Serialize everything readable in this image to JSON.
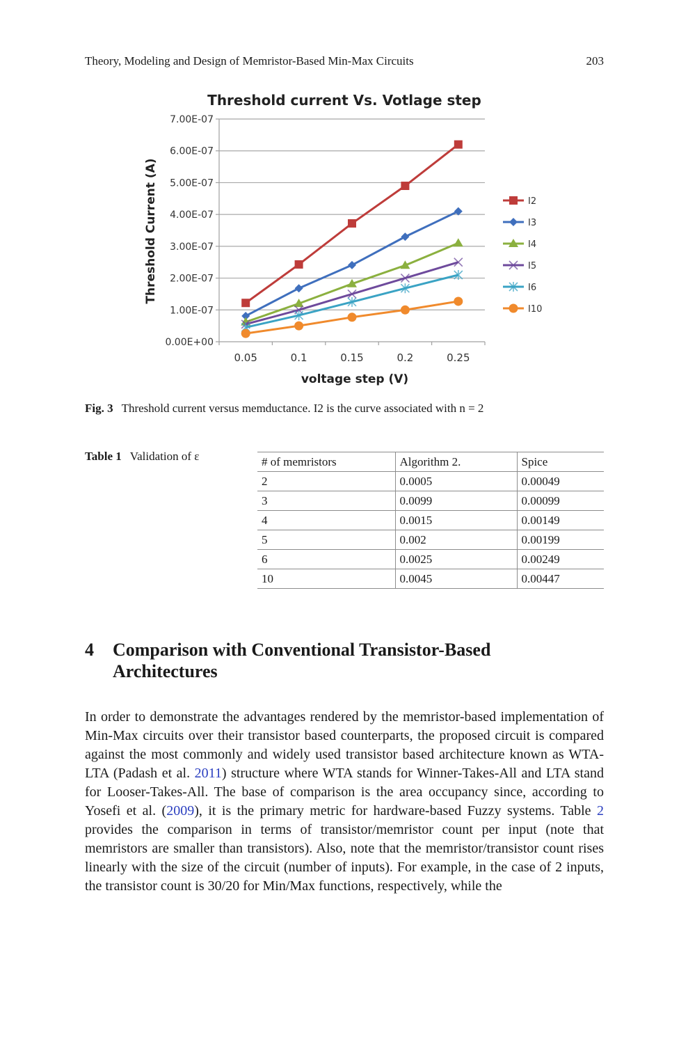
{
  "header": {
    "running_title": "Theory, Modeling and Design of Memristor-Based Min-Max Circuits",
    "page_number": "203"
  },
  "chart_data": {
    "type": "line",
    "title": "Threshold current Vs. Votlage step",
    "xlabel": "voltage step (V)",
    "ylabel": "Threshold Current (A)",
    "categories": [
      "0.05",
      "0.1",
      "0.15",
      "0.2",
      "0.25"
    ],
    "x": [
      0.05,
      0.1,
      0.15,
      0.2,
      0.25
    ],
    "ylim": [
      0,
      7e-07
    ],
    "yticks": [
      0,
      1e-07,
      2e-07,
      3e-07,
      4e-07,
      5e-07,
      6e-07,
      7e-07
    ],
    "ytick_labels": [
      "0.00E+00",
      "1.00E-07",
      "2.00E-07",
      "3.00E-07",
      "4.00E-07",
      "5.00E-07",
      "6.00E-07",
      "7.00E-07"
    ],
    "grid": "horizontal",
    "legend_position": "right",
    "series": [
      {
        "name": "I2",
        "color": "#be3c3a",
        "marker": "square",
        "values": [
          1.22e-07,
          2.43e-07,
          3.72e-07,
          4.9e-07,
          6.2e-07
        ]
      },
      {
        "name": "I3",
        "color": "#3f6fbd",
        "marker": "diamond",
        "values": [
          8.1e-08,
          1.68e-07,
          2.41e-07,
          3.3e-07,
          4.1e-07
        ]
      },
      {
        "name": "I4",
        "color": "#8bb03f",
        "marker": "triangle",
        "values": [
          6.2e-08,
          1.2e-07,
          1.82e-07,
          2.4e-07,
          3.1e-07
        ]
      },
      {
        "name": "I5",
        "color": "#6e4a9c",
        "marker": "x",
        "values": [
          5.5e-08,
          1e-07,
          1.5e-07,
          2e-07,
          2.5e-07
        ]
      },
      {
        "name": "I6",
        "color": "#3aa3c4",
        "marker": "star",
        "values": [
          4.5e-08,
          8.3e-08,
          1.25e-07,
          1.68e-07,
          2.1e-07
        ]
      },
      {
        "name": "I10",
        "color": "#f08a2c",
        "marker": "circle",
        "values": [
          2.6e-08,
          5e-08,
          7.7e-08,
          1e-07,
          1.27e-07
        ]
      }
    ]
  },
  "figure": {
    "label": "Fig. 3",
    "caption": "Threshold current versus memductance. I2 is the curve associated with n = 2"
  },
  "table1": {
    "label": "Table 1",
    "caption": "Validation of ε",
    "headers": [
      "# of memristors",
      "Algorithm 2.",
      "Spice"
    ],
    "rows": [
      [
        "2",
        "0.0005",
        "0.00049"
      ],
      [
        "3",
        "0.0099",
        "0.00099"
      ],
      [
        "4",
        "0.0015",
        "0.00149"
      ],
      [
        "5",
        "0.002",
        "0.00199"
      ],
      [
        "6",
        "0.0025",
        "0.00249"
      ],
      [
        "10",
        "0.0045",
        "0.00447"
      ]
    ]
  },
  "section": {
    "number": "4",
    "title": "Comparison with Conventional Transistor-Based Architectures"
  },
  "body": {
    "p1_a": "In order to demonstrate the advantages rendered by the memristor-based implementation of Min-Max circuits over their transistor based counterparts, the proposed circuit is compared against the most commonly and widely used transistor based architecture known as WTA-LTA (Padash et al. ",
    "ref_padash": "2011",
    "p1_b": ") structure where WTA stands for Winner-Takes-All and LTA stand for Looser-Takes-All. The base of comparison is the area occupancy since, according to Yosefi et al. (",
    "ref_yosefi": "2009",
    "p1_c": "), it is the primary metric for hardware-based Fuzzy systems. Table ",
    "ref_table2": "2",
    "p1_d": " provides the comparison in terms of transistor/memristor count per input (note that memristors are smaller than transistors). Also, note that the memristor/transistor count rises linearly with the size of the circuit (number of inputs). For example, in the case of 2 inputs, the transistor count is 30/20 for Min/Max functions, respectively, while the"
  }
}
